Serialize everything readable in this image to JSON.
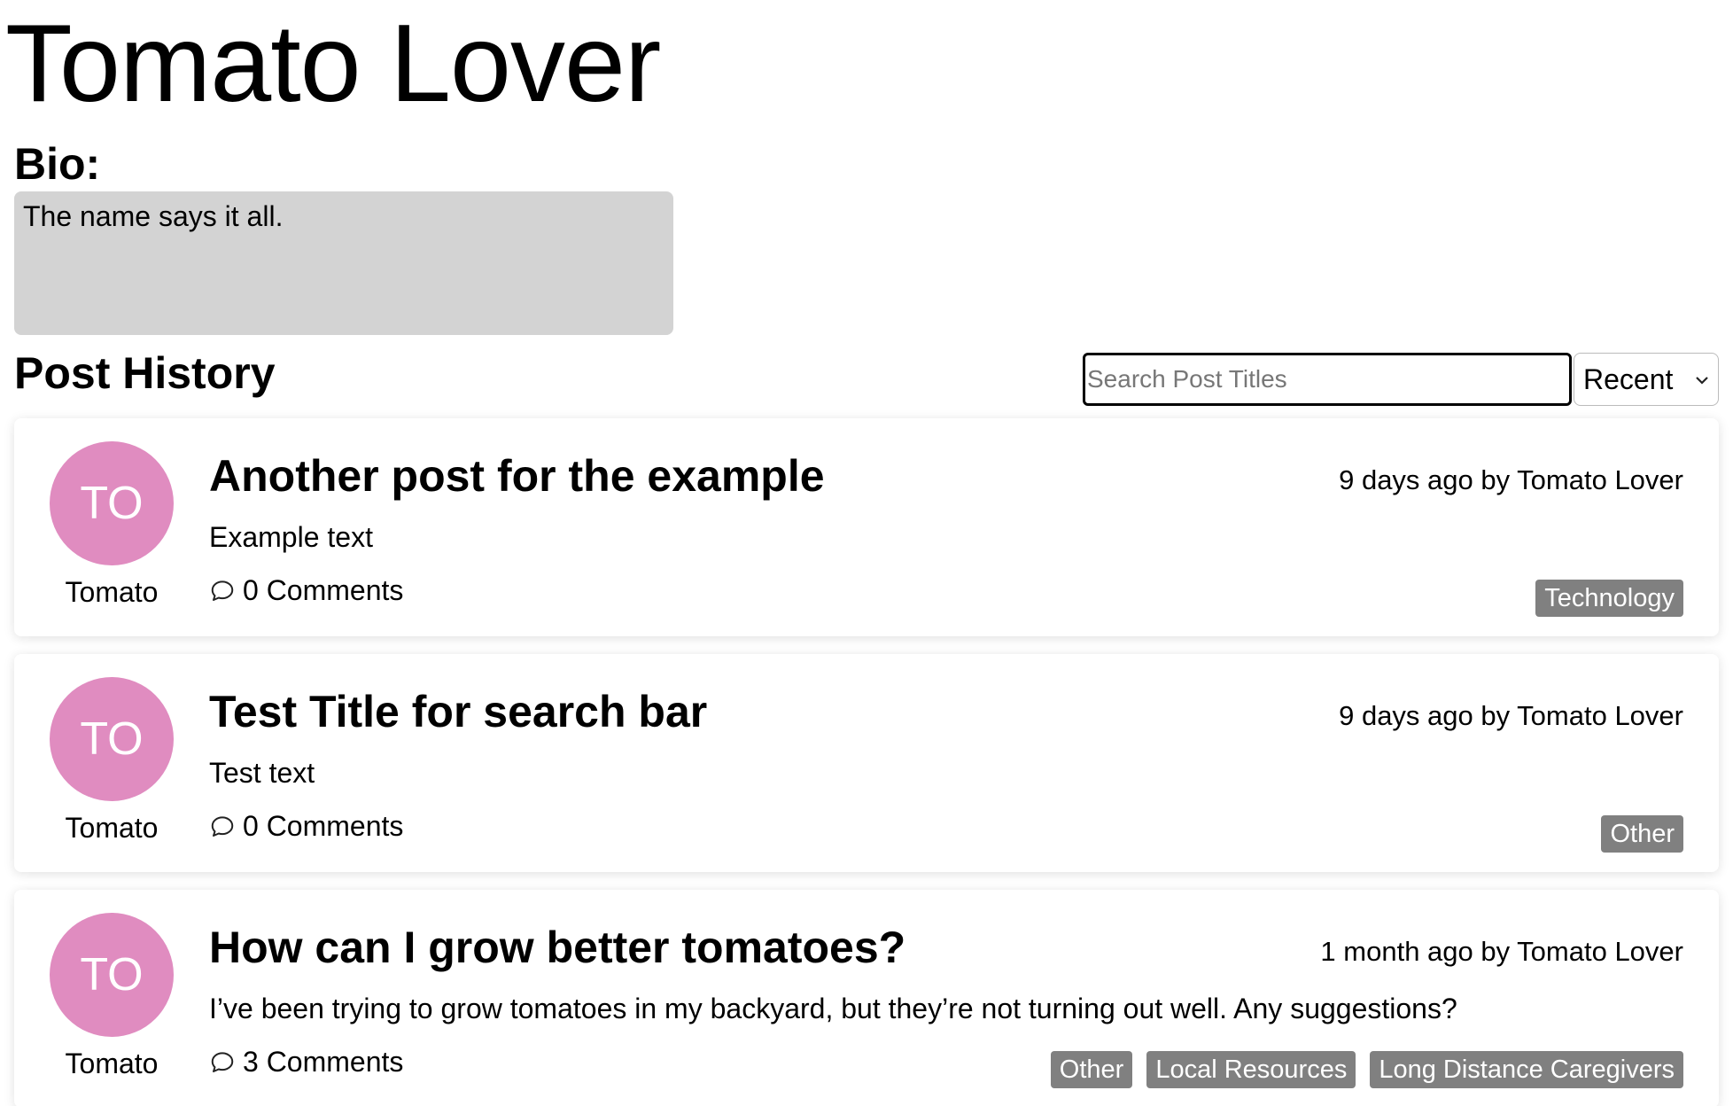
{
  "profile": {
    "name": "Tomato Lover",
    "bio_heading": "Bio:",
    "bio_text": "The name says it all."
  },
  "history": {
    "heading": "Post History",
    "search_placeholder": "Search Post Titles",
    "search_value": "",
    "sort_selected": "Recent"
  },
  "colors": {
    "avatar": "#e08cc0",
    "tag": "#808080",
    "bio_bg": "#d3d3d3"
  },
  "posts": [
    {
      "avatar_initials": "TO",
      "author_short": "Tomato",
      "title": "Another post for the example",
      "meta": "9 days ago by Tomato Lover",
      "excerpt": "Example text",
      "comments": "0 Comments",
      "tags": [
        "Technology"
      ]
    },
    {
      "avatar_initials": "TO",
      "author_short": "Tomato",
      "title": "Test Title for search bar",
      "meta": "9 days ago by Tomato Lover",
      "excerpt": "Test text",
      "comments": "0 Comments",
      "tags": [
        "Other"
      ]
    },
    {
      "avatar_initials": "TO",
      "author_short": "Tomato",
      "title": "How can I grow better tomatoes?",
      "meta": "1 month ago by Tomato Lover",
      "excerpt": "I’ve been trying to grow tomatoes in my backyard, but they’re not turning out well. Any suggestions?",
      "comments": "3 Comments",
      "tags": [
        "Other",
        "Local Resources",
        "Long Distance Caregivers"
      ]
    }
  ]
}
